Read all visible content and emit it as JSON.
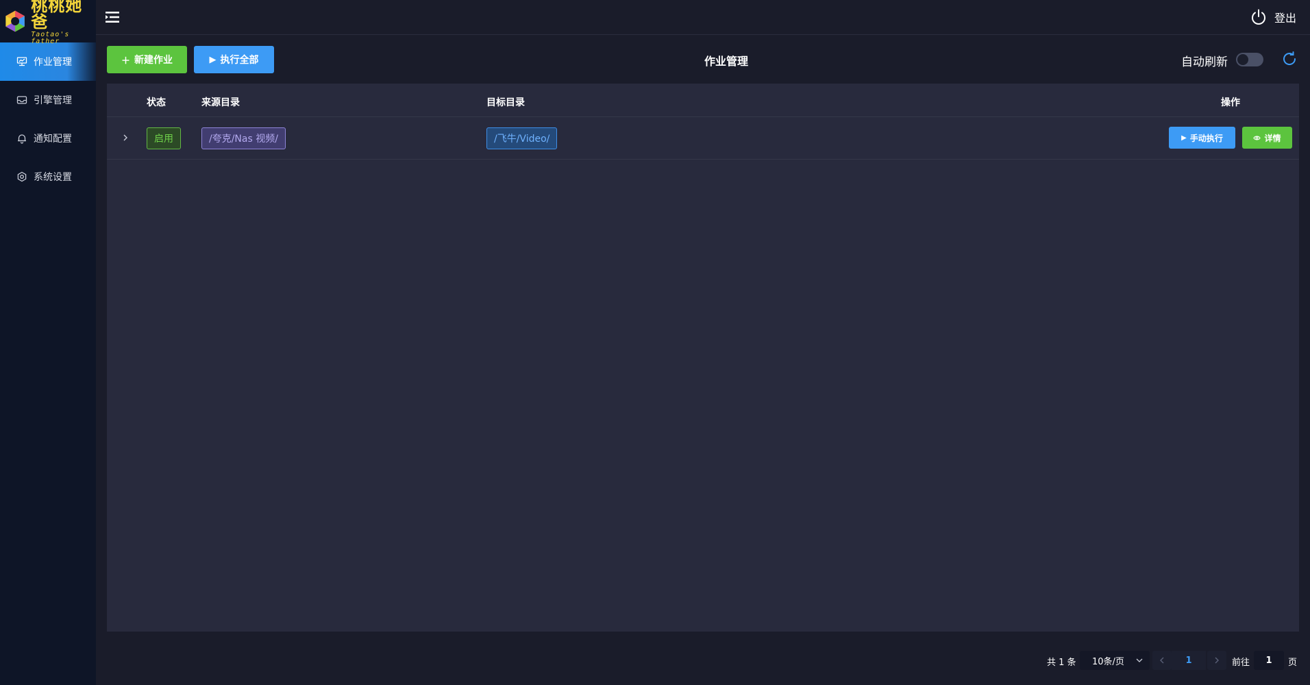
{
  "brand": {
    "name": "桃桃她爸",
    "tagline": "Taotao's father"
  },
  "sidebar": {
    "items": [
      {
        "label": "作业管理",
        "icon": "presentation-icon",
        "active": true
      },
      {
        "label": "引擎管理",
        "icon": "inbox-icon",
        "active": false
      },
      {
        "label": "通知配置",
        "icon": "bell-icon",
        "active": false
      },
      {
        "label": "系统设置",
        "icon": "gear-icon",
        "active": false
      }
    ]
  },
  "header": {
    "logout_label": "登出"
  },
  "toolbar": {
    "new_job_label": "新建作业",
    "run_all_label": "执行全部",
    "page_title": "作业管理",
    "auto_refresh_label": "自动刷新",
    "auto_refresh_on": false
  },
  "table": {
    "columns": {
      "status": "状态",
      "source": "来源目录",
      "target": "目标目录",
      "actions": "操作"
    },
    "rows": [
      {
        "status": "启用",
        "source": "/夸克/Nas 视频/",
        "target": "/飞牛/Video/",
        "run_label": "手动执行",
        "detail_label": "详情"
      }
    ]
  },
  "pagination": {
    "total_label": "共 1 条",
    "page_size": "10条/页",
    "current_page": "1",
    "goto_label": "前往",
    "goto_value": "1",
    "page_suffix": "页"
  },
  "colors": {
    "accent_blue": "#3d9bf5",
    "accent_green": "#5cc43e",
    "background": "#1a1c2a",
    "sidebar": "#0e1527",
    "table": "#282a3d",
    "brand_yellow": "#f2d43a"
  }
}
